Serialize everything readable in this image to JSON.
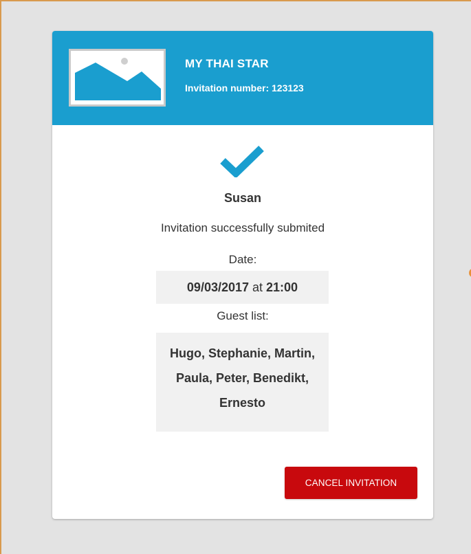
{
  "header": {
    "restaurant_name": "MY THAI STAR",
    "invitation_number": "Invitation number: 123123",
    "thumbnail_icon": "image-placeholder-icon",
    "background_color": "#1a9ecf"
  },
  "content": {
    "status_icon": "checkmark-icon",
    "guest_name": "Susan",
    "status_text": "Invitation successfully submited",
    "date_label": "Date:",
    "date_value": "09/03/2017",
    "date_connector": " at ",
    "time_value": "21:00",
    "guest_list_label": "Guest list:",
    "guest_list": "Hugo, Stephanie, Martin, Paula, Peter, Benedikt, Ernesto"
  },
  "actions": {
    "cancel_label": "CANCEL INVITATION",
    "cancel_color": "#c8090d"
  }
}
